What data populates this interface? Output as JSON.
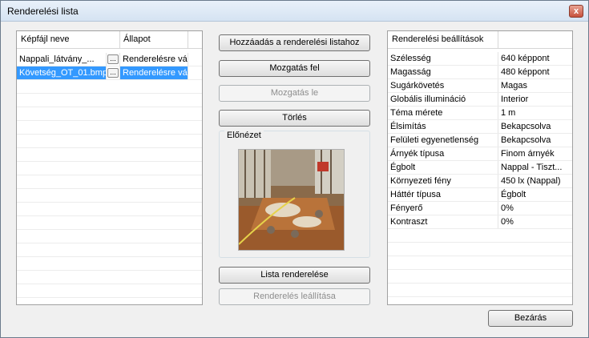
{
  "window": {
    "title": "Renderelési lista",
    "close_glyph": "x"
  },
  "file_list": {
    "columns": [
      "Képfájl neve",
      "Állapot"
    ],
    "rows": [
      {
        "file": "Nappali_látvány_...",
        "status": "Renderelésre vár",
        "selected": false
      },
      {
        "file": "Követség_OT_01.bmp",
        "status": "Renderelésre vár",
        "selected": true
      }
    ],
    "dots_label": "..."
  },
  "buttons": {
    "add": "Hozzáadás a renderelési listahoz",
    "move_up": "Mozgatás fel",
    "move_down": "Mozgatás le",
    "delete": "Törlés",
    "render_list": "Lista renderelése",
    "stop_render": "Renderelés leállítása",
    "close": "Bezárás"
  },
  "preview": {
    "label": "Előnézet"
  },
  "settings": {
    "header": "Renderelési beállítások",
    "rows": [
      {
        "name": "Szélesség",
        "value": "640 képpont"
      },
      {
        "name": "Magasság",
        "value": "480 képpont"
      },
      {
        "name": "Sugárkövetés",
        "value": "Magas"
      },
      {
        "name": "Globális illumináció",
        "value": "Interior"
      },
      {
        "name": "Téma mérete",
        "value": "1 m"
      },
      {
        "name": "Élsimítás",
        "value": "Bekapcsolva"
      },
      {
        "name": "Felületi egyenetlenség",
        "value": "Bekapcsolva"
      },
      {
        "name": "Árnyék típusa",
        "value": "Finom árnyék"
      },
      {
        "name": "Égbolt",
        "value": "Nappal - Tiszt..."
      },
      {
        "name": "Környezeti fény",
        "value": "450 lx (Nappal)"
      },
      {
        "name": "Háttér típusa",
        "value": "Égbolt"
      },
      {
        "name": "Fényerő",
        "value": "0%"
      },
      {
        "name": "Kontraszt",
        "value": "0%"
      }
    ]
  },
  "colors": {
    "selection": "#3399ff",
    "window_bg": "#f0f0f0"
  }
}
